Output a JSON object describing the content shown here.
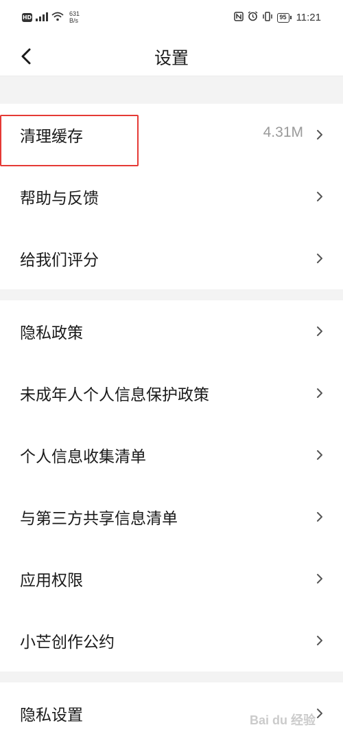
{
  "status_bar": {
    "hd": "HD",
    "net_speed_value": "631",
    "net_speed_unit": "B/s",
    "battery": "95",
    "time": "11:21"
  },
  "header": {
    "title": "设置"
  },
  "groups": [
    {
      "items": [
        {
          "label": "清理缓存",
          "value": "4.31M"
        },
        {
          "label": "帮助与反馈"
        },
        {
          "label": "给我们评分"
        }
      ]
    },
    {
      "items": [
        {
          "label": "隐私政策"
        },
        {
          "label": "未成年人个人信息保护政策"
        },
        {
          "label": "个人信息收集清单"
        },
        {
          "label": "与第三方共享信息清单"
        },
        {
          "label": "应用权限"
        },
        {
          "label": "小芒创作公约"
        }
      ]
    },
    {
      "items": [
        {
          "label": "隐私设置"
        }
      ]
    }
  ],
  "watermark": "Bai du 经验",
  "colors": {
    "highlight": "#e53935",
    "section_gap": "#f3f3f3",
    "value_text": "#9a9a9a"
  }
}
